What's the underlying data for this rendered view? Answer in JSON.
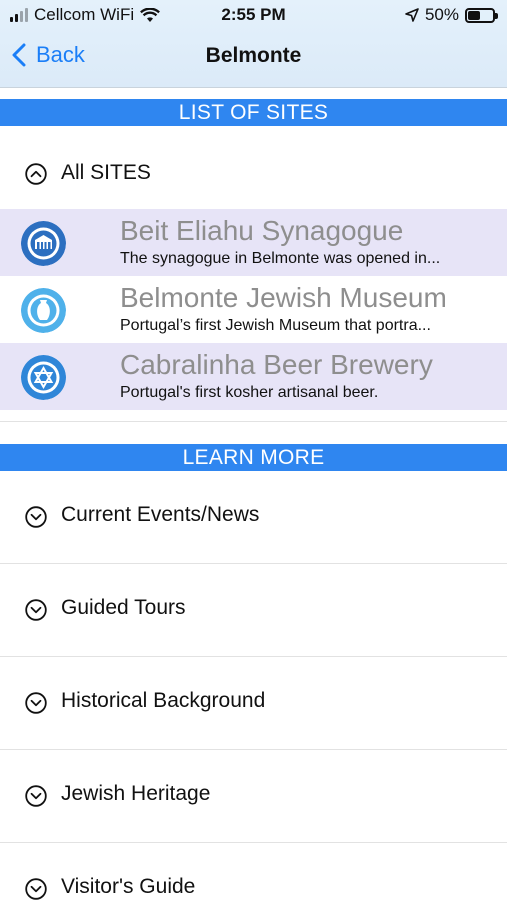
{
  "status_bar": {
    "carrier": "Cellcom WiFi",
    "time": "2:55 PM",
    "battery_percent": "50%",
    "battery_level": 0.5
  },
  "nav": {
    "back_label": "Back",
    "title": "Belmonte"
  },
  "sites_section": {
    "header": "LIST OF SITES",
    "all_sites_label": "All SITES",
    "items": [
      {
        "title": "Beit Eliahu Synagogue",
        "description": "The synagogue in Belmonte was opened in...",
        "icon": "synagogue-icon"
      },
      {
        "title": "Belmonte Jewish Museum",
        "description": "Portugal’s first Jewish Museum that portra...",
        "icon": "vase-icon"
      },
      {
        "title": "Cabralinha Beer Brewery",
        "description": "Portugal's first kosher artisanal beer.",
        "icon": "star-of-david-icon"
      }
    ]
  },
  "learn_more": {
    "header": "LEARN MORE",
    "items": [
      {
        "label": "Current Events/News"
      },
      {
        "label": "Guided Tours"
      },
      {
        "label": "Historical Background"
      },
      {
        "label": "Jewish Heritage"
      },
      {
        "label": "Visitor's Guide"
      }
    ]
  },
  "colors": {
    "accent": "#1a7ef7",
    "section_header": "#2f86f0",
    "row_highlight": "#e7e4f7",
    "title_gray": "#8e8e8e"
  }
}
